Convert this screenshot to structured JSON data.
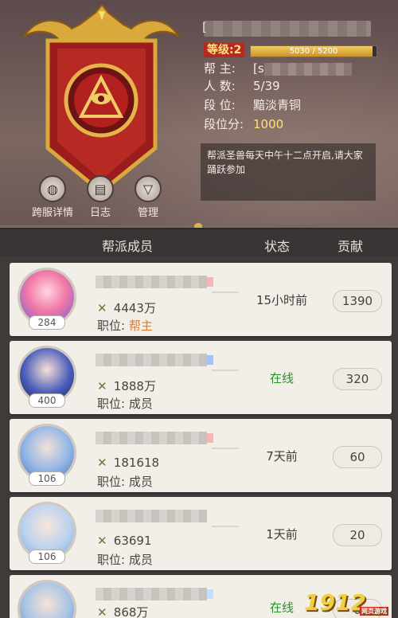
{
  "header": {
    "guild_name_prefix": "[",
    "level_label": "等级:2",
    "xp_text": "5030 / 5200",
    "xp_fraction": 0.967,
    "leader_key": "帮  主:",
    "leader_value": "[s",
    "members_key": "人  数:",
    "members_value": "5/39",
    "rank_key": "段  位:",
    "rank_value": "黯淡青铜",
    "score_key": "段位分:",
    "score_value": "1000",
    "notice": "帮派圣兽每天中午十二点开启,请大家踊跃参加"
  },
  "actions": [
    {
      "label": "跨服详情",
      "icon": "globe-icon"
    },
    {
      "label": "日志",
      "icon": "book-icon"
    },
    {
      "label": "管理",
      "icon": "emblem-icon"
    }
  ],
  "table": {
    "col_members": "帮派成员",
    "col_status": "状态",
    "col_contrib": "贡献"
  },
  "members": [
    {
      "level": "284",
      "power": "4443万",
      "role_label": "职位:",
      "role": "帮主",
      "status": "15小时前",
      "online": false,
      "contribution": "1390"
    },
    {
      "level": "400",
      "power": "1888万",
      "role_label": "职位:",
      "role": "成员",
      "status": "在线",
      "online": true,
      "contribution": "320"
    },
    {
      "level": "106",
      "power": "181618",
      "role_label": "职位:",
      "role": "成员",
      "status": "7天前",
      "online": false,
      "contribution": "60"
    },
    {
      "level": "106",
      "power": "63691",
      "role_label": "职位:",
      "role": "成员",
      "status": "1天前",
      "online": false,
      "contribution": "20"
    },
    {
      "level": "",
      "power": "868万",
      "role_label": "",
      "role": "",
      "status": "在线",
      "online": true,
      "contribution": "0"
    }
  ],
  "brand": {
    "text": "1912",
    "sub": "网页游戏"
  },
  "colors": {
    "accent_gold": "#d9b64d",
    "online": "#2f8f2f",
    "leader": "#e07a2e"
  }
}
